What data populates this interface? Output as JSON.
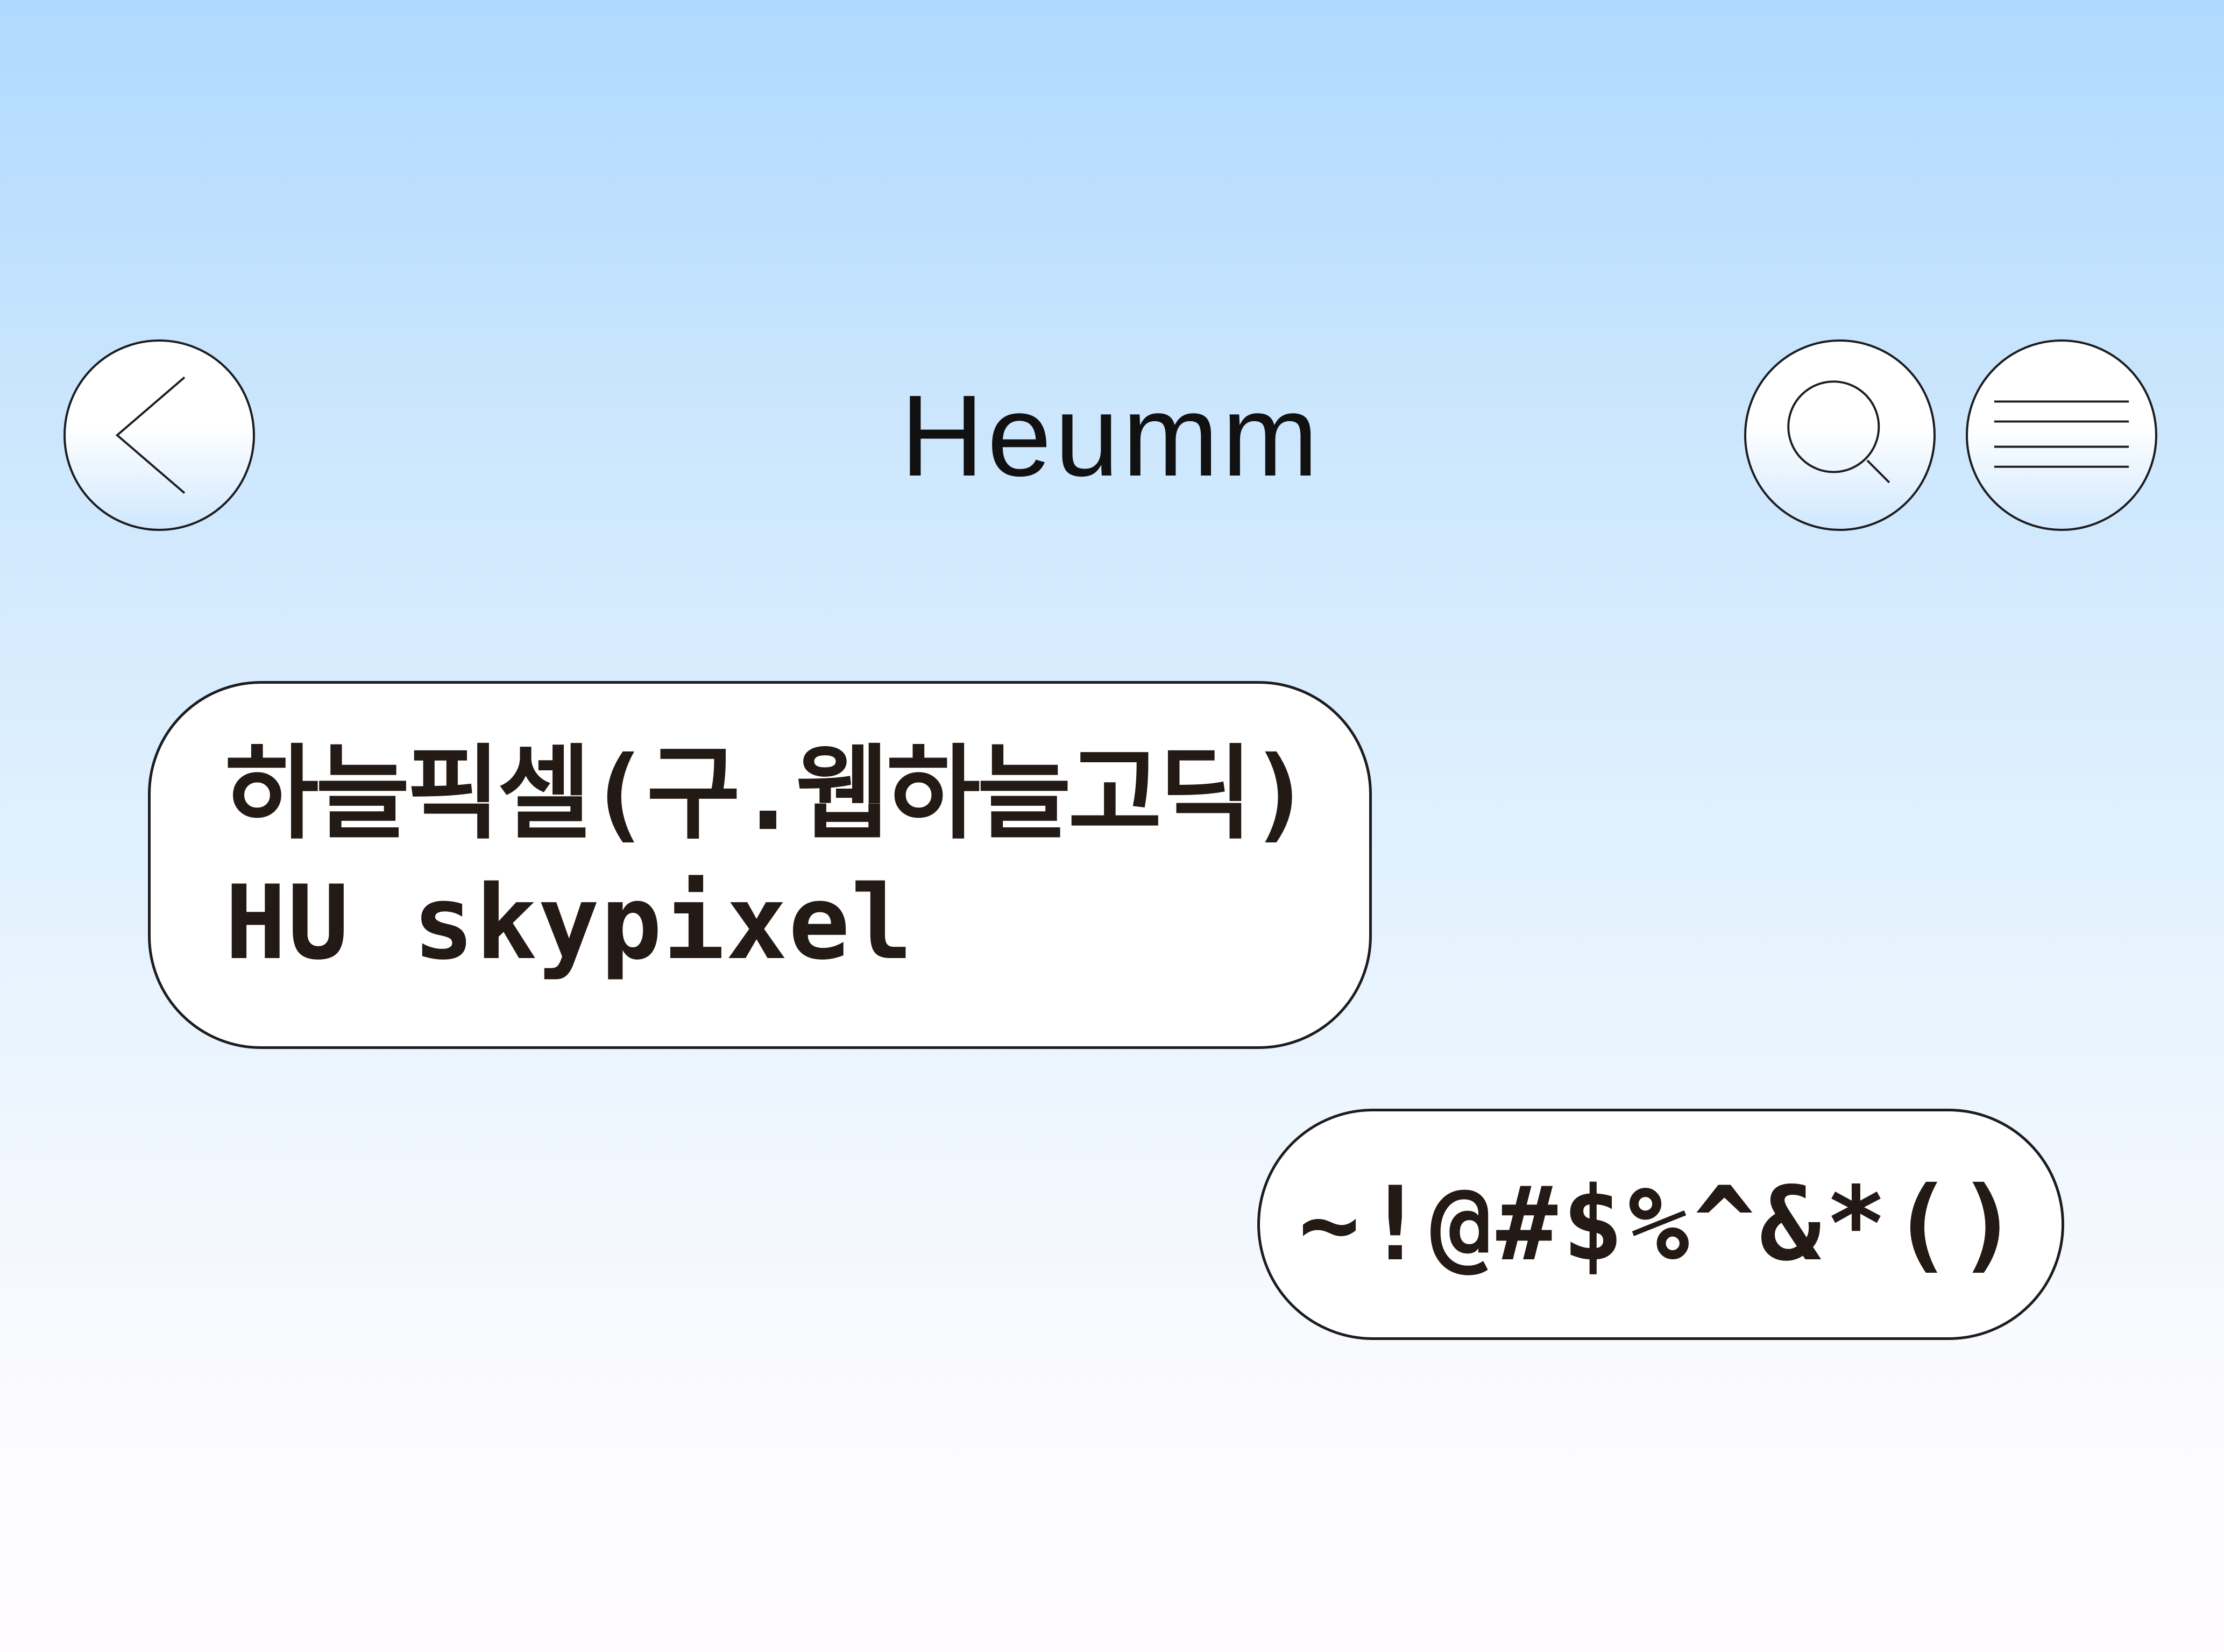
{
  "header": {
    "title": "Heumm",
    "back_icon": "chevron-left-icon",
    "search_icon": "search-icon",
    "menu_icon": "hamburger-menu-icon"
  },
  "messages": [
    {
      "lines": [
        "하늘픽셀(구.웹하늘고딕)",
        "HU skypixel"
      ]
    },
    {
      "lines": [
        "~!@#$%^&*()"
      ]
    }
  ],
  "colors": {
    "sky_top": "#afd9fe",
    "sky_bottom": "#fdfbfe",
    "bubble_fill": "#ffffff",
    "outline": "#1d1d1f",
    "text": "#231915"
  }
}
